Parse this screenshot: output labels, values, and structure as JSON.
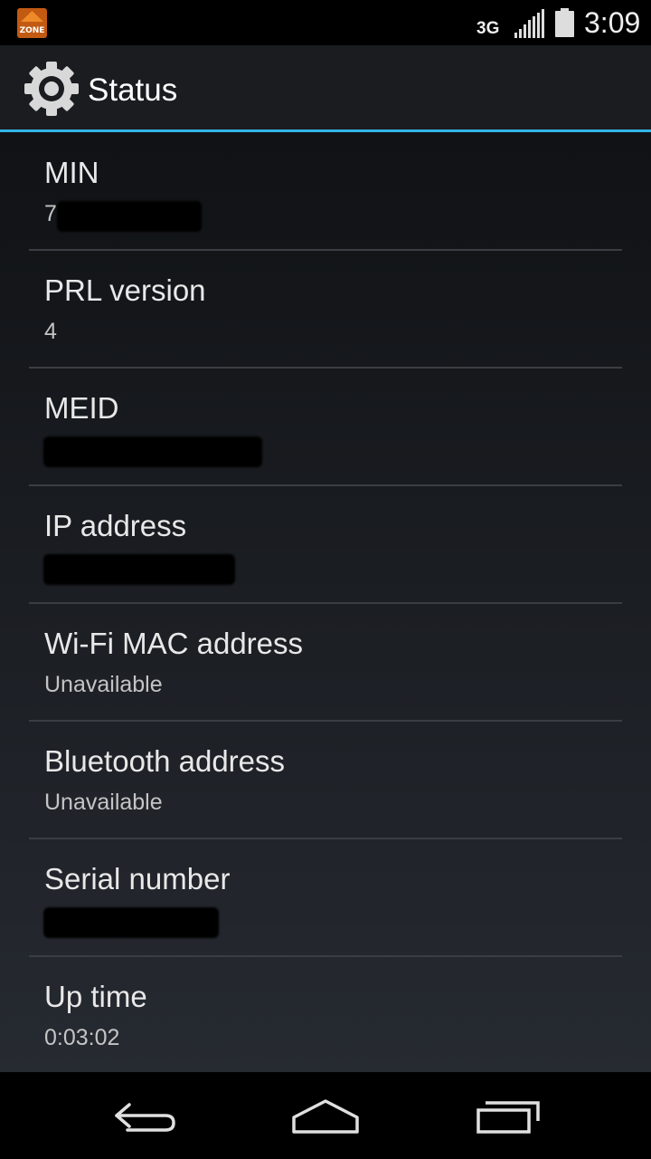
{
  "status_bar": {
    "notification_icon": "zone-app-icon",
    "notification_text": "ZONE",
    "network_type": "3G",
    "signal_icon": "signal-bars-icon",
    "battery_icon": "battery-icon",
    "time": "3:09"
  },
  "action_bar": {
    "icon": "settings-gear-icon",
    "title": "Status"
  },
  "items": [
    {
      "label": "MIN",
      "value": "7"
    },
    {
      "label": "PRL version",
      "value": "4"
    },
    {
      "label": "MEID",
      "value": ""
    },
    {
      "label": "IP address",
      "value": ""
    },
    {
      "label": "Wi-Fi MAC address",
      "value": "Unavailable"
    },
    {
      "label": "Bluetooth address",
      "value": "Unavailable"
    },
    {
      "label": "Serial number",
      "value": ""
    },
    {
      "label": "Up time",
      "value": "0:03:02"
    }
  ],
  "nav": {
    "back_icon": "back-icon",
    "home_icon": "home-icon",
    "recents_icon": "recent-apps-icon"
  },
  "colors": {
    "accent": "#33b5e5",
    "action_bar_bg": "#1a1c1f",
    "divider": "#3a3e44"
  }
}
